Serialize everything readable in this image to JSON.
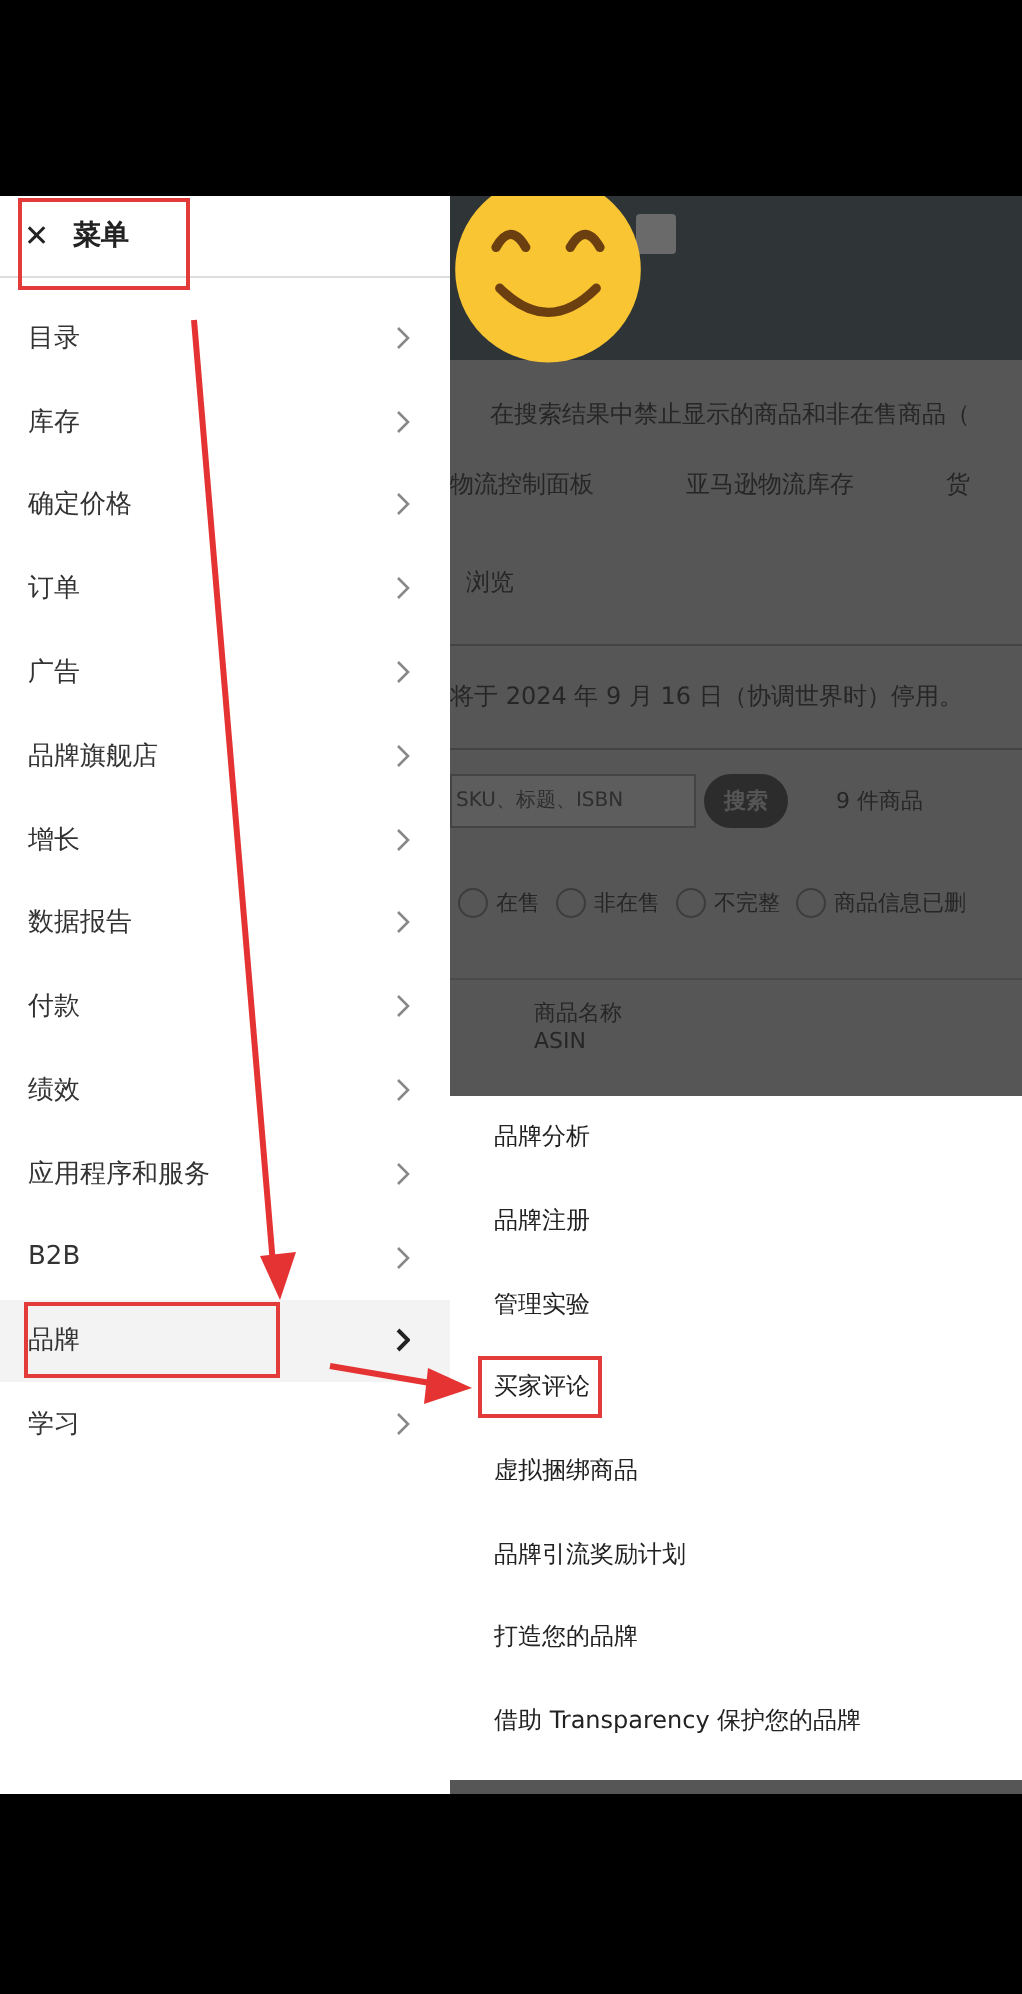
{
  "menu": {
    "close": "✕",
    "title": "菜单",
    "title_highlighted": true,
    "items": [
      {
        "label": "目录",
        "selected": false
      },
      {
        "label": "库存",
        "selected": false
      },
      {
        "label": "确定价格",
        "selected": false
      },
      {
        "label": "订单",
        "selected": false
      },
      {
        "label": "广告",
        "selected": false
      },
      {
        "label": "品牌旗舰店",
        "selected": false
      },
      {
        "label": "增长",
        "selected": false
      },
      {
        "label": "数据报告",
        "selected": false
      },
      {
        "label": "付款",
        "selected": false
      },
      {
        "label": "绩效",
        "selected": false
      },
      {
        "label": "应用程序和服务",
        "selected": false
      },
      {
        "label": "B2B",
        "selected": false
      },
      {
        "label": "品牌",
        "selected": true,
        "highlighted": true
      },
      {
        "label": "学习",
        "selected": false
      }
    ]
  },
  "submenu": {
    "items": [
      {
        "label": "品牌分析"
      },
      {
        "label": "品牌注册"
      },
      {
        "label": "管理实验"
      },
      {
        "label": "买家评论",
        "highlighted": true
      },
      {
        "label": "虚拟捆绑商品"
      },
      {
        "label": "品牌引流奖励计划"
      },
      {
        "label": "打造您的品牌"
      },
      {
        "label": "借助 Transparency 保护您的品牌"
      }
    ]
  },
  "background": {
    "notice": "在搜索结果中禁止显示的商品和非在售商品（",
    "tabs": [
      "物流控制面板",
      "亚马逊物流库存",
      "货"
    ],
    "browse": "浏览",
    "notice_2": "将于 2024 年 9 月 16 日（协调世界时）停用。",
    "search": {
      "placeholder": "SKU、标题、ISBN",
      "button": "搜索",
      "count": "9 件商品"
    },
    "filters": [
      {
        "label": "在售",
        "selected": false
      },
      {
        "label": "非在售",
        "selected": false
      },
      {
        "label": "不完整",
        "selected": false
      },
      {
        "label": "商品信息已删",
        "selected": false
      }
    ],
    "column": {
      "title": "商品名称",
      "subtitle": "ASIN"
    }
  }
}
